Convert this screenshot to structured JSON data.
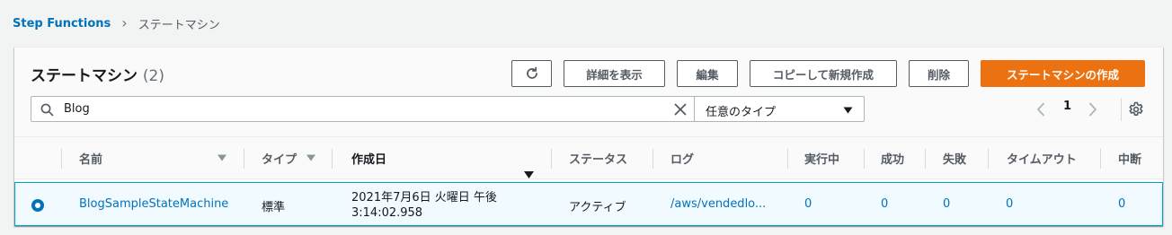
{
  "breadcrumb": {
    "root": "Step Functions",
    "separator": "›",
    "current": "ステートマシン"
  },
  "header": {
    "title": "ステートマシン",
    "count": "(2)",
    "buttons": {
      "refresh_icon": "refresh-icon",
      "details": "詳細を表示",
      "edit": "編集",
      "copy_new": "コピーして新規作成",
      "delete": "削除",
      "create": "ステートマシンの作成"
    },
    "search": {
      "value": "Blog"
    },
    "type_filter": {
      "value": "任意のタイプ"
    },
    "pagination": {
      "page": "1"
    }
  },
  "table": {
    "columns": {
      "name": "名前",
      "type": "タイプ",
      "created": "作成日",
      "status": "ステータス",
      "log": "ログ",
      "running": "実行中",
      "succeeded": "成功",
      "failed": "失敗",
      "timed_out": "タイムアウト",
      "aborted": "中断"
    },
    "rows": [
      {
        "name": "BlogSampleStateMachine",
        "type": "標準",
        "created_line1": "2021年7月6日 火曜日 午後",
        "created_line2": "3:14:02.958",
        "status": "アクティブ",
        "log": "/aws/vendedlo...",
        "running": "0",
        "succeeded": "0",
        "failed": "0",
        "timed_out": "0",
        "aborted": "0"
      }
    ]
  },
  "colors": {
    "link": "#0073bb",
    "primary": "#ec7211",
    "selected_row": "#f1faff",
    "selected_border": "#00a1c9"
  }
}
